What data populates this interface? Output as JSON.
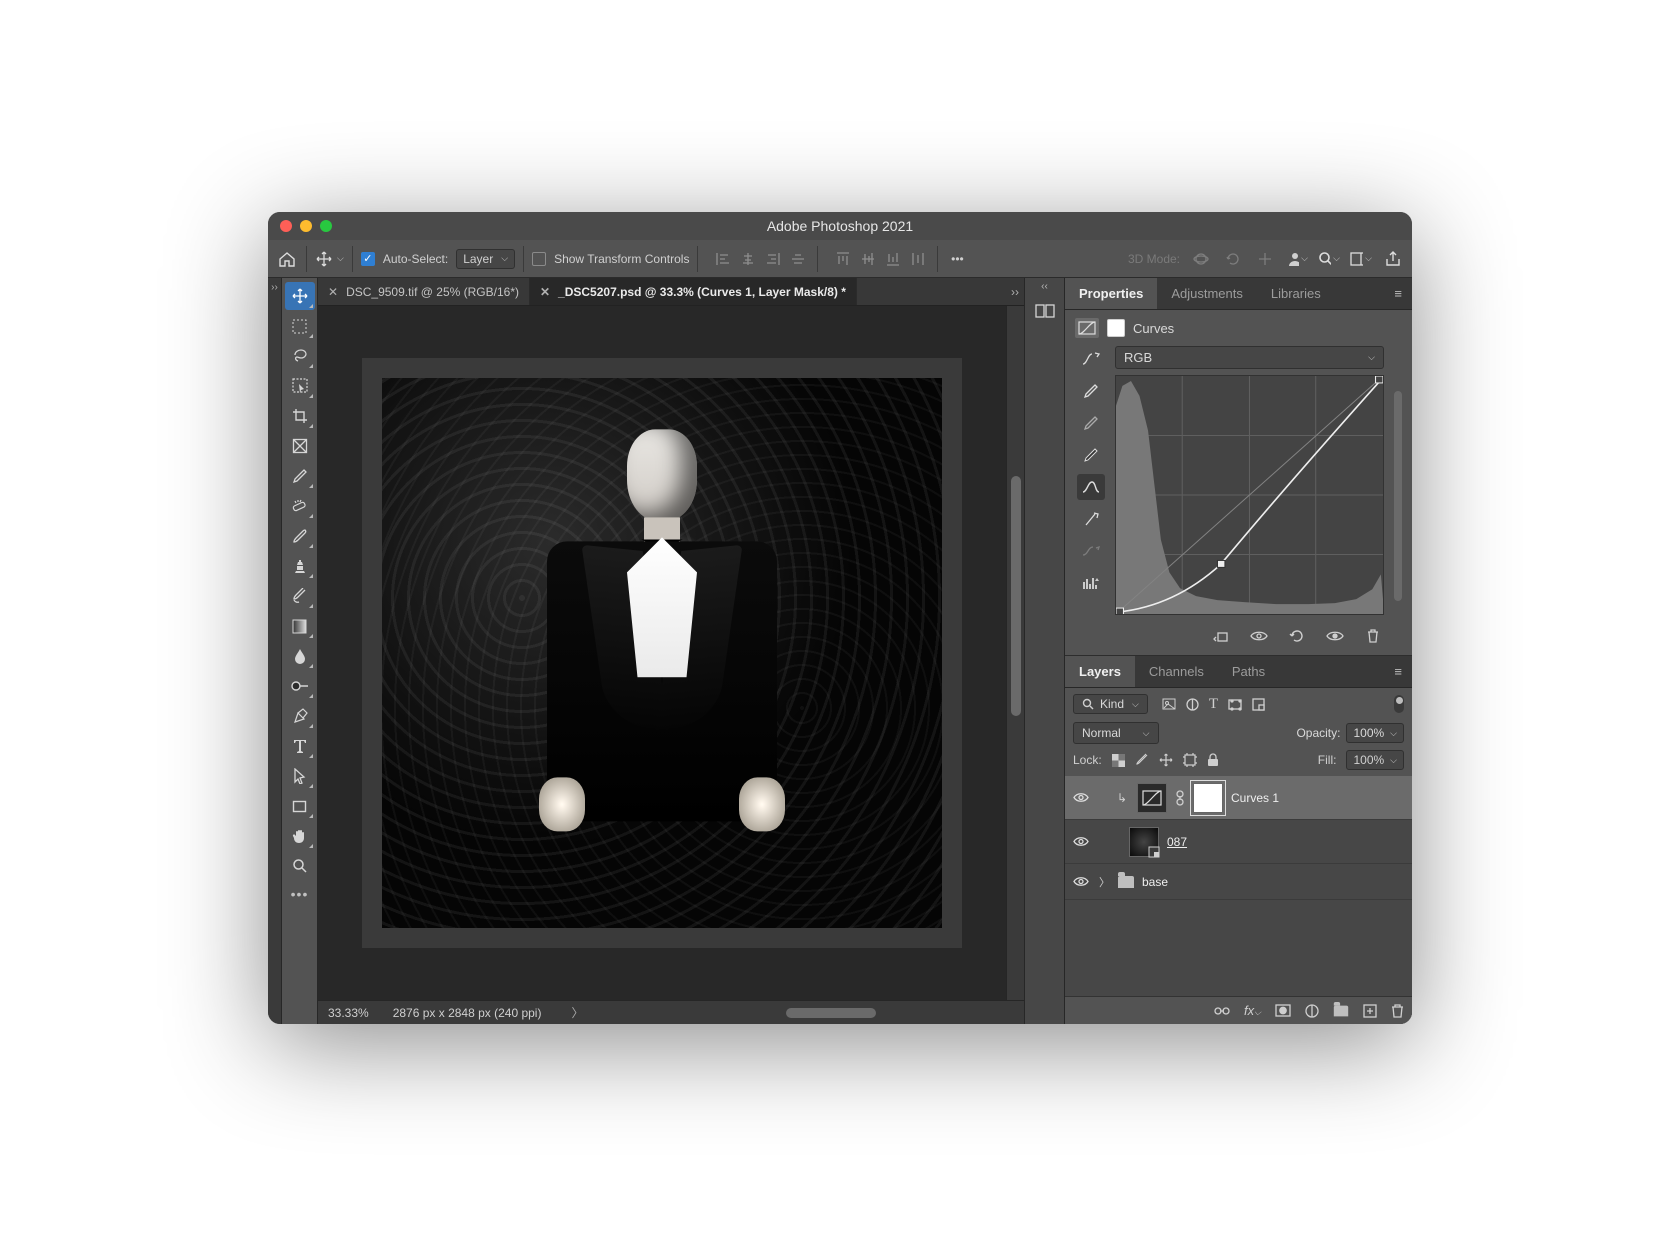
{
  "window": {
    "title": "Adobe Photoshop 2021"
  },
  "options": {
    "auto_select_label": "Auto-Select:",
    "layer_dropdown": "Layer",
    "show_transform_label": "Show Transform Controls",
    "mode_3d_label": "3D Mode:"
  },
  "tabs": [
    {
      "label": "DSC_9509.tif @ 25% (RGB/16*)",
      "active": false
    },
    {
      "label": "_DSC5207.psd @ 33.3% (Curves 1, Layer Mask/8) *",
      "active": true
    }
  ],
  "status": {
    "zoom": "33.33%",
    "doc_dims": "2876 px x 2848 px (240 ppi)"
  },
  "properties": {
    "tab_properties": "Properties",
    "tab_adjustments": "Adjustments",
    "tab_libraries": "Libraries",
    "adjustment_name": "Curves",
    "channel": "RGB"
  },
  "layers_panel": {
    "tab_layers": "Layers",
    "tab_channels": "Channels",
    "tab_paths": "Paths",
    "filter_kind_label": "Kind",
    "blend_mode": "Normal",
    "opacity_label": "Opacity:",
    "opacity_value": "100%",
    "lock_label": "Lock:",
    "fill_label": "Fill:",
    "fill_value": "100%",
    "layers": [
      {
        "name": "Curves 1",
        "type": "adjustment",
        "clipped": true,
        "selected": true
      },
      {
        "name": "087",
        "type": "smart",
        "underline": true
      },
      {
        "name": "base",
        "type": "group"
      }
    ]
  },
  "search_icon": "𝗤"
}
